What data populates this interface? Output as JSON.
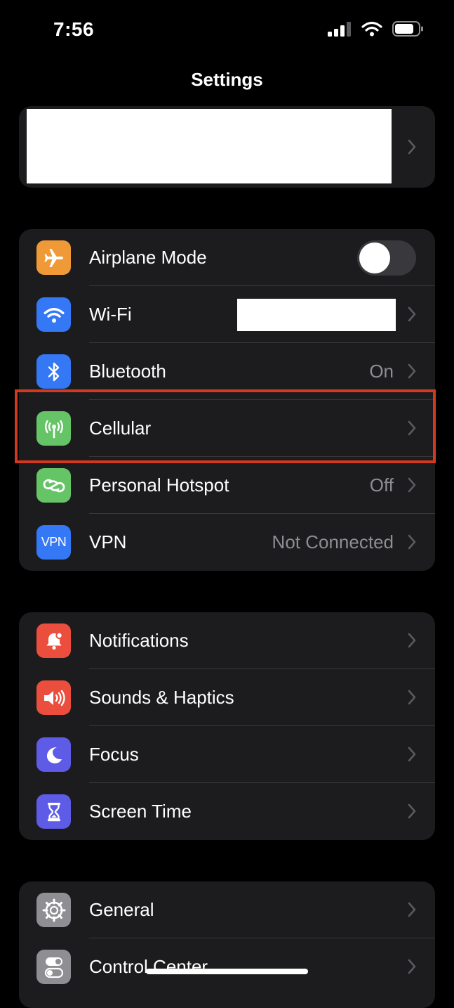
{
  "status_bar": {
    "time": "7:56"
  },
  "nav": {
    "title": "Settings"
  },
  "groups": [
    [
      {
        "id": "airplane",
        "label": "Airplane Mode",
        "icon": "airplane-icon",
        "color": "#f09a37",
        "toggle": false
      },
      {
        "id": "wifi",
        "label": "Wi-Fi",
        "icon": "wifi-icon",
        "color": "#3478f6"
      },
      {
        "id": "bluetooth",
        "label": "Bluetooth",
        "value": "On",
        "icon": "bluetooth-icon",
        "color": "#3478f6"
      },
      {
        "id": "cellular",
        "label": "Cellular",
        "icon": "cellular-antenna-icon",
        "color": "#65c466"
      },
      {
        "id": "hotspot",
        "label": "Personal Hotspot",
        "value": "Off",
        "icon": "hotspot-link-icon",
        "color": "#65c466"
      },
      {
        "id": "vpn",
        "label": "VPN",
        "value": "Not Connected",
        "icon": "vpn-icon",
        "icon_text": "VPN",
        "color": "#3478f6"
      }
    ],
    [
      {
        "id": "notifications",
        "label": "Notifications",
        "icon": "notification-bell-icon",
        "color": "#eb4e3d"
      },
      {
        "id": "sounds",
        "label": "Sounds & Haptics",
        "icon": "speaker-icon",
        "color": "#eb4e3d"
      },
      {
        "id": "focus",
        "label": "Focus",
        "icon": "moon-icon",
        "color": "#5e5ce6"
      },
      {
        "id": "screentime",
        "label": "Screen Time",
        "icon": "hourglass-icon",
        "color": "#5e5ce6"
      }
    ],
    [
      {
        "id": "general",
        "label": "General",
        "icon": "gear-icon",
        "color": "#8e8e93"
      },
      {
        "id": "controlcenter",
        "label": "Control Center",
        "icon": "toggles-icon",
        "color": "#8e8e93"
      }
    ]
  ],
  "colors": {
    "background": "#000000",
    "cell": "#1c1c1e",
    "separator": "#38383a",
    "secondary_text": "#8d8d93",
    "highlight": "#d4391f"
  }
}
